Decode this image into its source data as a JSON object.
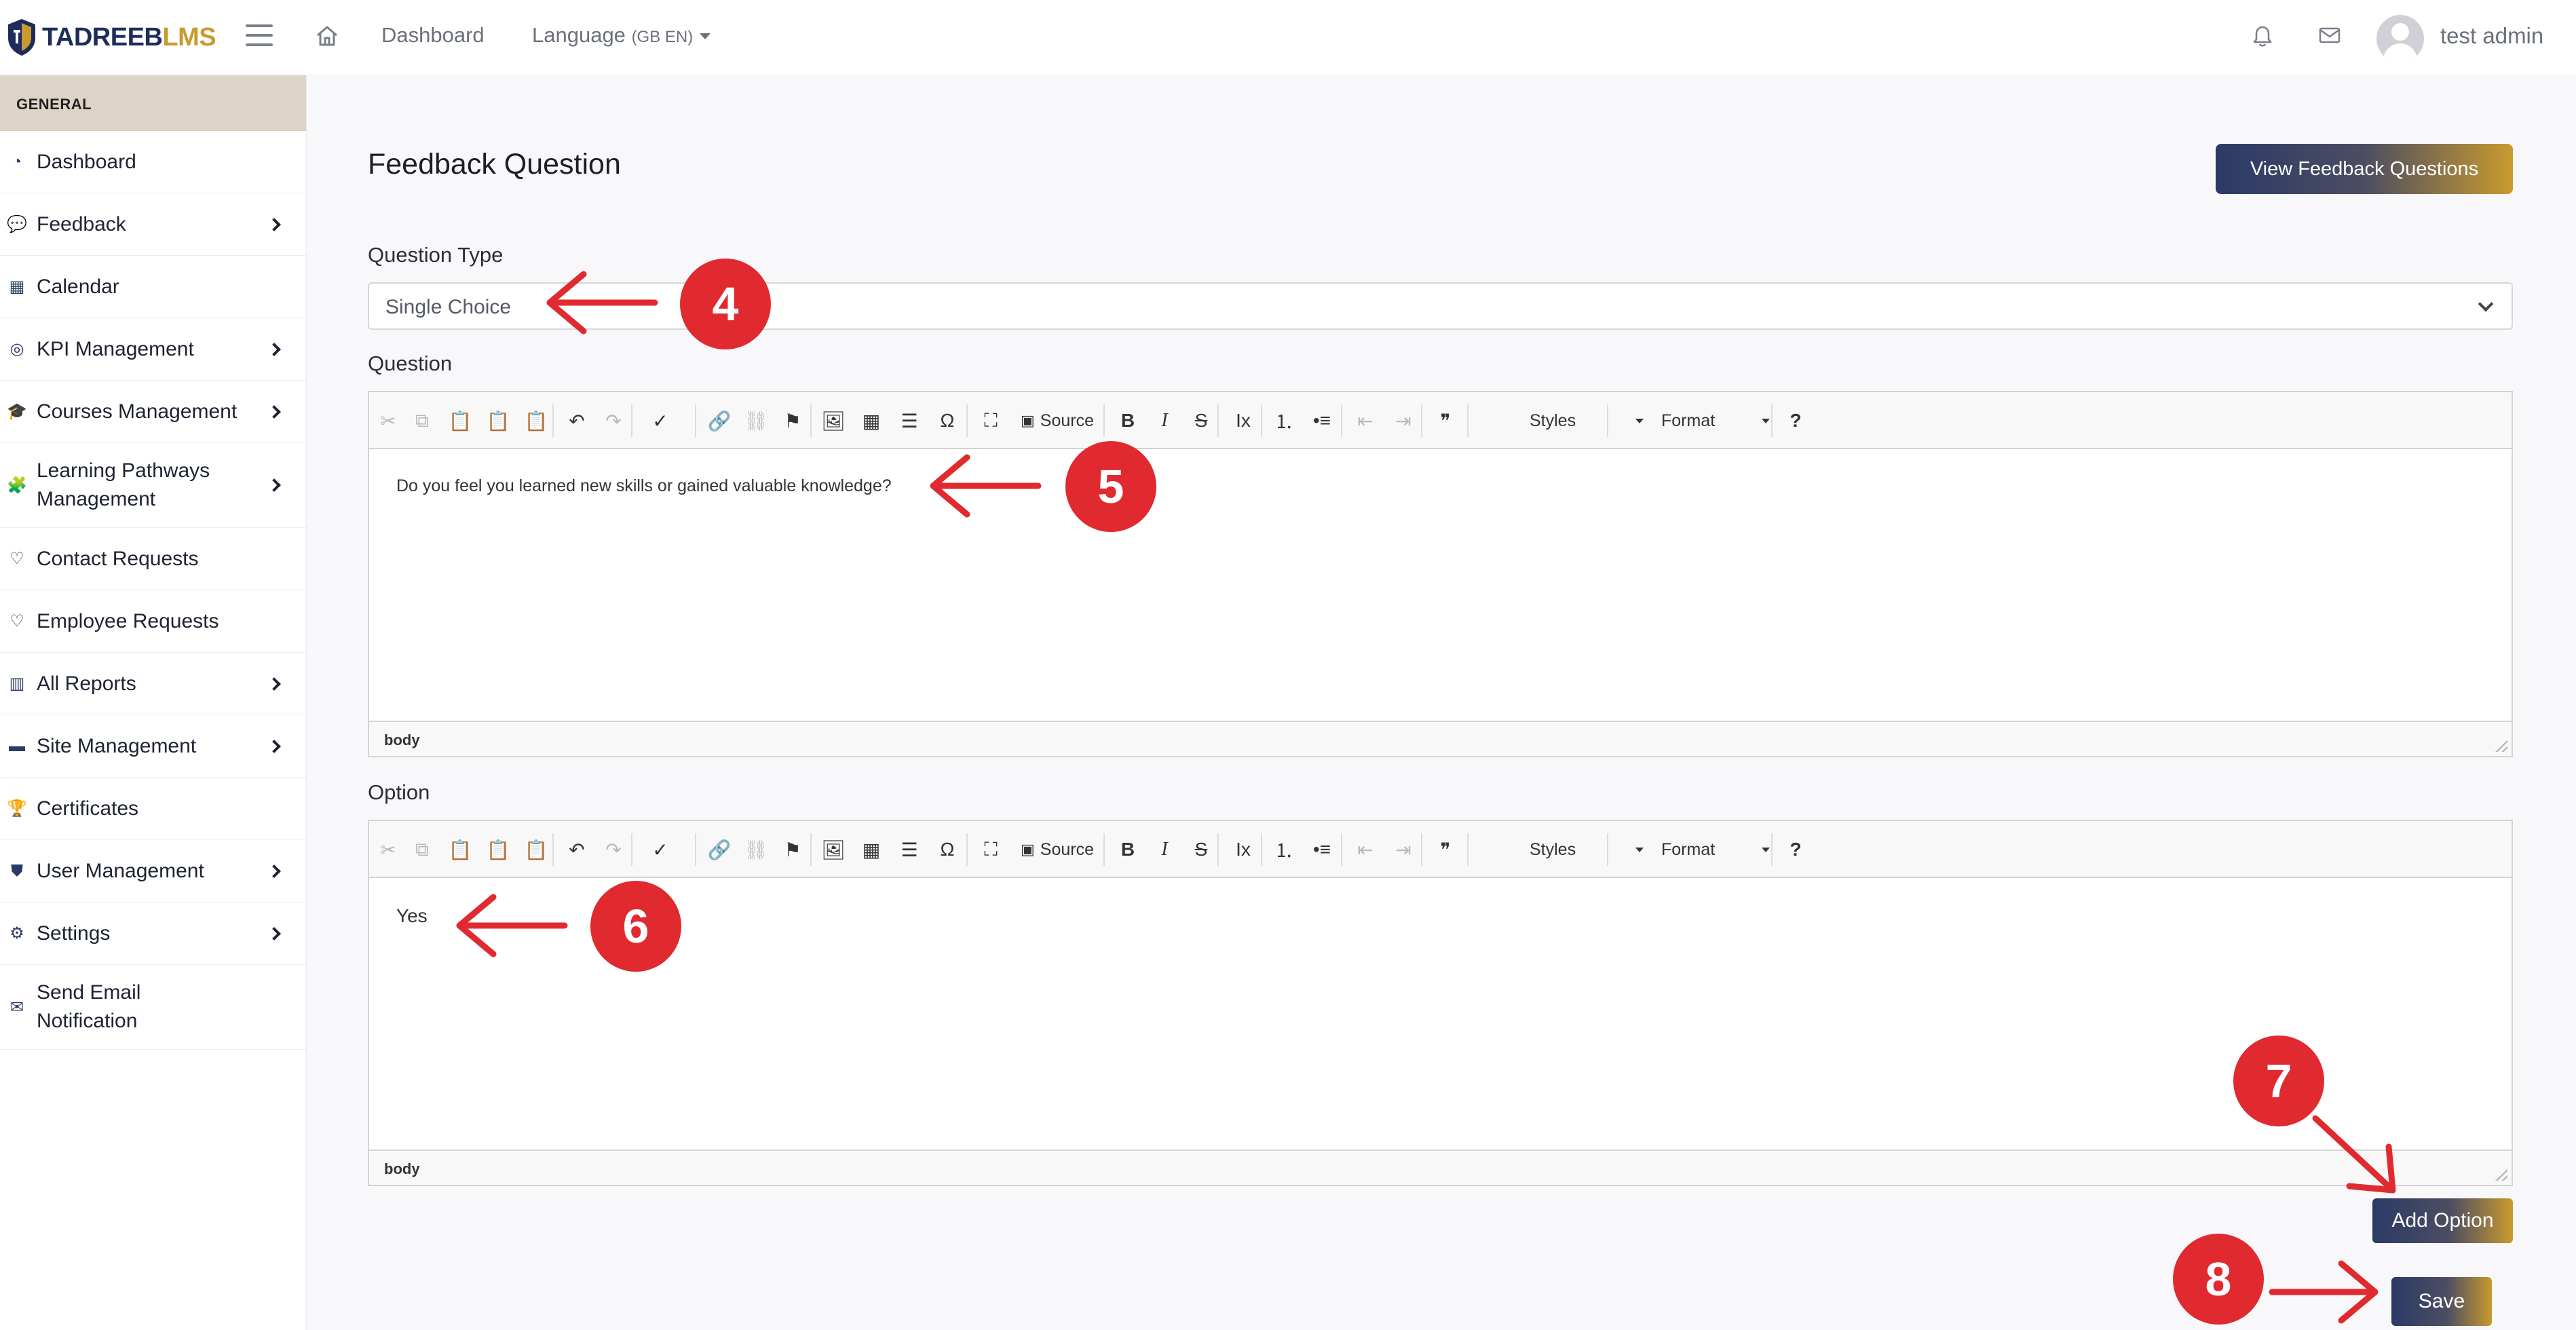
{
  "app": {
    "logo_part1": "TADREEB",
    "logo_part2": "LMS"
  },
  "topbar": {
    "dashboard_label": "Dashboard",
    "language_label": "Language",
    "language_value": "(GB EN)",
    "user_name": "test admin"
  },
  "sidebar": {
    "section_title": "GENERAL",
    "items": [
      {
        "label": "Dashboard",
        "icon": "dashboard-icon",
        "has_children": false
      },
      {
        "label": "Feedback",
        "icon": "comments-icon",
        "has_children": true
      },
      {
        "label": "Calendar",
        "icon": "calendar-icon",
        "has_children": false
      },
      {
        "label": "KPI Management",
        "icon": "target-icon",
        "has_children": true
      },
      {
        "label": "Courses Management",
        "icon": "graduation-cap-icon",
        "has_children": true
      },
      {
        "label": "Learning Pathways Management",
        "icon": "puzzle-icon",
        "has_children": true
      },
      {
        "label": "Contact Requests",
        "icon": "handshake-icon",
        "has_children": false
      },
      {
        "label": "Employee Requests",
        "icon": "handshake-icon",
        "has_children": false
      },
      {
        "label": "All Reports",
        "icon": "chart-icon",
        "has_children": true
      },
      {
        "label": "Site Management",
        "icon": "folder-icon",
        "has_children": true
      },
      {
        "label": "Certificates",
        "icon": "trophy-icon",
        "has_children": false
      },
      {
        "label": "User Management",
        "icon": "shield-icon",
        "has_children": true
      },
      {
        "label": "Settings",
        "icon": "gear-icon",
        "has_children": true
      },
      {
        "label": "Send Email Notification",
        "icon": "envelope-icon",
        "has_children": false
      }
    ]
  },
  "main": {
    "page_title": "Feedback Question",
    "view_button": "View Feedback Questions",
    "question_type_label": "Question Type",
    "question_type_value": "Single Choice",
    "question_label": "Question",
    "question_text": "Do you feel you learned new skills or gained valuable knowledge?",
    "option_label": "Option",
    "option_text": "Yes",
    "editor_footer": "body",
    "add_option_button": "Add Option",
    "save_button": "Save"
  },
  "toolbar": {
    "source_label": "Source",
    "styles_label": "Styles",
    "format_label": "Format",
    "bold": "B",
    "italic": "I",
    "strike": "S",
    "help": "?",
    "omega": "Ω",
    "quote": "❞"
  },
  "annotations": {
    "step4": "4",
    "step5": "5",
    "step6": "6",
    "step7": "7",
    "step8": "8"
  },
  "colors": {
    "brand_navy": "#2b3a66",
    "brand_gold": "#c99a2e",
    "annotation_red": "#e02a30",
    "sidebar_header": "#ddd3c7"
  }
}
